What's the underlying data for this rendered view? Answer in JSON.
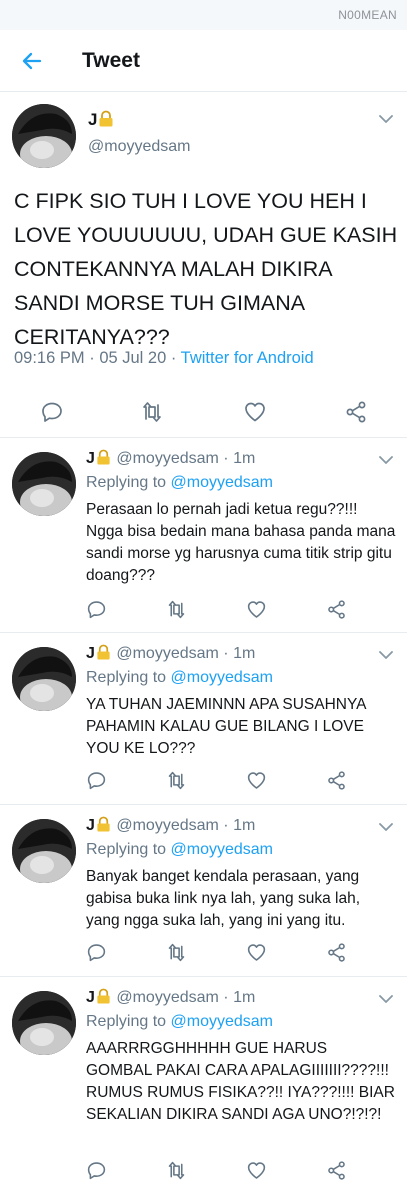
{
  "status_bar": {
    "carrier": "N00MEAN"
  },
  "header": {
    "title": "Tweet",
    "back_icon": "arrow-left-icon",
    "accent": "#1da1f2"
  },
  "main_tweet": {
    "name": "J",
    "handle": "@moyyedsam",
    "text": "C FIPK SIO TUH I LOVE YOU HEH I LOVE YOUUUUUU, UDAH GUE KASIH CONTEKANNYA MALAH DIKIRA SANDI MORSE TUH GIMANA CERITANYA???",
    "time": "09:16 PM",
    "date": "05 Jul 20",
    "source": "Twitter for Android"
  },
  "replies": [
    {
      "name": "J",
      "handle": "@moyyedsam",
      "age": "1m",
      "replying_label": "Replying to",
      "replying_to": "@moyyedsam",
      "text": "Perasaan lo pernah jadi ketua regu??!!! Ngga bisa bedain mana bahasa panda mana sandi morse yg harusnya cuma titik strip gitu doang???"
    },
    {
      "name": "J",
      "handle": "@moyyedsam",
      "age": "1m",
      "replying_label": "Replying to",
      "replying_to": "@moyyedsam",
      "text": "YA TUHAN JAEMINNN APA SUSAHNYA PAHAMIN KALAU GUE BILANG I LOVE YOU KE LO???"
    },
    {
      "name": "J",
      "handle": "@moyyedsam",
      "age": "1m",
      "replying_label": "Replying to",
      "replying_to": "@moyyedsam",
      "text": "Banyak banget kendala perasaan, yang gabisa buka link nya lah, yang suka lah, yang ngga suka lah, yang ini yang itu."
    },
    {
      "name": "J",
      "handle": "@moyyedsam",
      "age": "1m",
      "replying_label": "Replying to",
      "replying_to": "@moyyedsam",
      "text": "AAARRRGGHHHHH GUE HARUS GOMBAL PAKAI CARA APALAGIIIIIII????!!! RUMUS RUMUS FISIKA??!! IYA???!!!! BIAR SEKALIAN DIKIRA SANDI AGA UNO?!?!?!"
    }
  ],
  "icons": {
    "lock": "lock-icon",
    "reply": "reply-icon",
    "retweet": "retweet-icon",
    "like": "heart-icon",
    "share": "share-icon",
    "more": "chevron-down-icon"
  }
}
